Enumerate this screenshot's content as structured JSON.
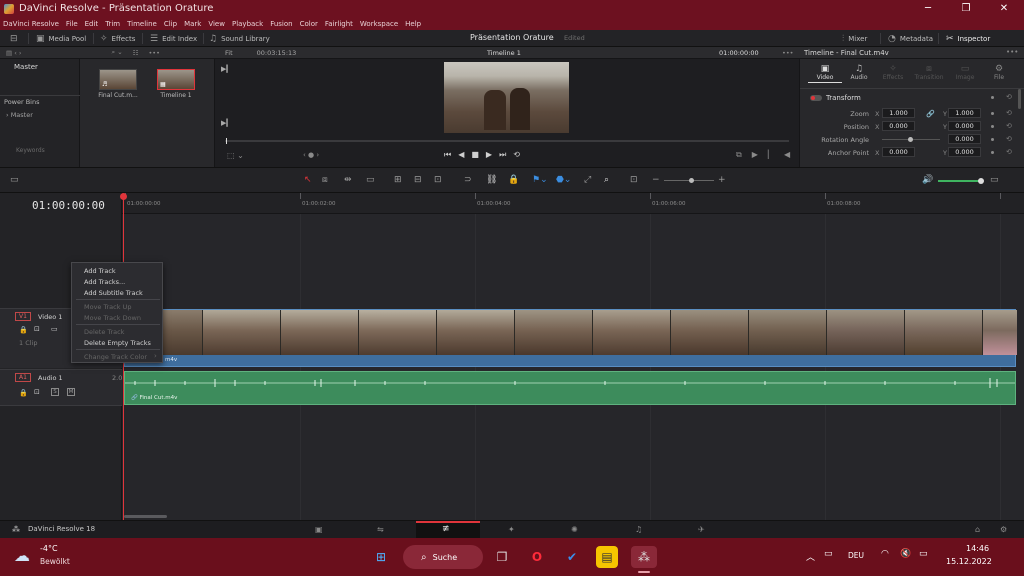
{
  "window": {
    "title": "DaVinci Resolve - Präsentation Orature",
    "minimize": "─",
    "maximize": "❐",
    "close": "✕"
  },
  "menu": [
    "DaVinci Resolve",
    "File",
    "Edit",
    "Trim",
    "Timeline",
    "Clip",
    "Mark",
    "View",
    "Playback",
    "Fusion",
    "Color",
    "Fairlight",
    "Workspace",
    "Help"
  ],
  "toolbar": {
    "media_pool": "Media Pool",
    "effects": "Effects",
    "edit_index": "Edit Index",
    "sound_library": "Sound Library",
    "project_title": "Präsentation Orature",
    "project_status": "Edited",
    "mixer": "Mixer",
    "metadata": "Metadata",
    "inspector": "Inspector"
  },
  "bins": {
    "master": "Master",
    "power_bins": "Power Bins",
    "power_master": "Master",
    "keywords": "Keywords"
  },
  "media_pool": {
    "clips": [
      {
        "name": "Final Cut.m..."
      },
      {
        "name": "Timeline 1"
      }
    ]
  },
  "viewer": {
    "fit": "Fit",
    "duration": "00:03:15:13",
    "timeline_name": "Timeline 1",
    "timecode": "01:00:00:00"
  },
  "inspector": {
    "title": "Timeline - Final Cut.m4v",
    "tabs": [
      "Video",
      "Audio",
      "Effects",
      "Transition",
      "Image",
      "File"
    ],
    "section": "Transform",
    "rows": [
      {
        "label": "Zoom",
        "x": "1.000",
        "y": "1.000"
      },
      {
        "label": "Position",
        "x": "0.000",
        "y": "0.000"
      },
      {
        "label": "Rotation Angle",
        "y": "0.000"
      },
      {
        "label": "Anchor Point",
        "x": "0.000",
        "y": "0.000"
      }
    ],
    "axis_x": "X",
    "axis_y": "Y"
  },
  "timeline": {
    "timecode": "01:00:00:00",
    "ruler": [
      "01:00:00:00",
      "01:00:02:00",
      "01:00:04:00",
      "01:00:06:00",
      "01:00:08:00"
    ],
    "video_track": {
      "id": "V1",
      "name": "Video 1",
      "clips": "1 Clip",
      "clip_label": "m4v"
    },
    "audio_track": {
      "id": "A1",
      "name": "Audio 1",
      "channels": "2.0",
      "solo": "S",
      "mute": "M",
      "clip_label": "Final Cut.m4v"
    }
  },
  "context_menu": [
    {
      "label": "Add Track",
      "enabled": true
    },
    {
      "label": "Add Tracks...",
      "enabled": true
    },
    {
      "label": "Add Subtitle Track",
      "enabled": true
    },
    {
      "label": "Move Track Up",
      "enabled": false
    },
    {
      "label": "Move Track Down",
      "enabled": false
    },
    {
      "label": "Delete Track",
      "enabled": false
    },
    {
      "label": "Delete Empty Tracks",
      "enabled": true
    },
    {
      "label": "Change Track Color",
      "enabled": false
    }
  ],
  "pagebar": {
    "app": "DaVinci Resolve 18"
  },
  "taskbar": {
    "weather_temp": "-4°C",
    "weather_desc": "Bewölkt",
    "search": "Suche",
    "lang": "DEU",
    "time": "14:46",
    "date": "15.12.2022"
  }
}
